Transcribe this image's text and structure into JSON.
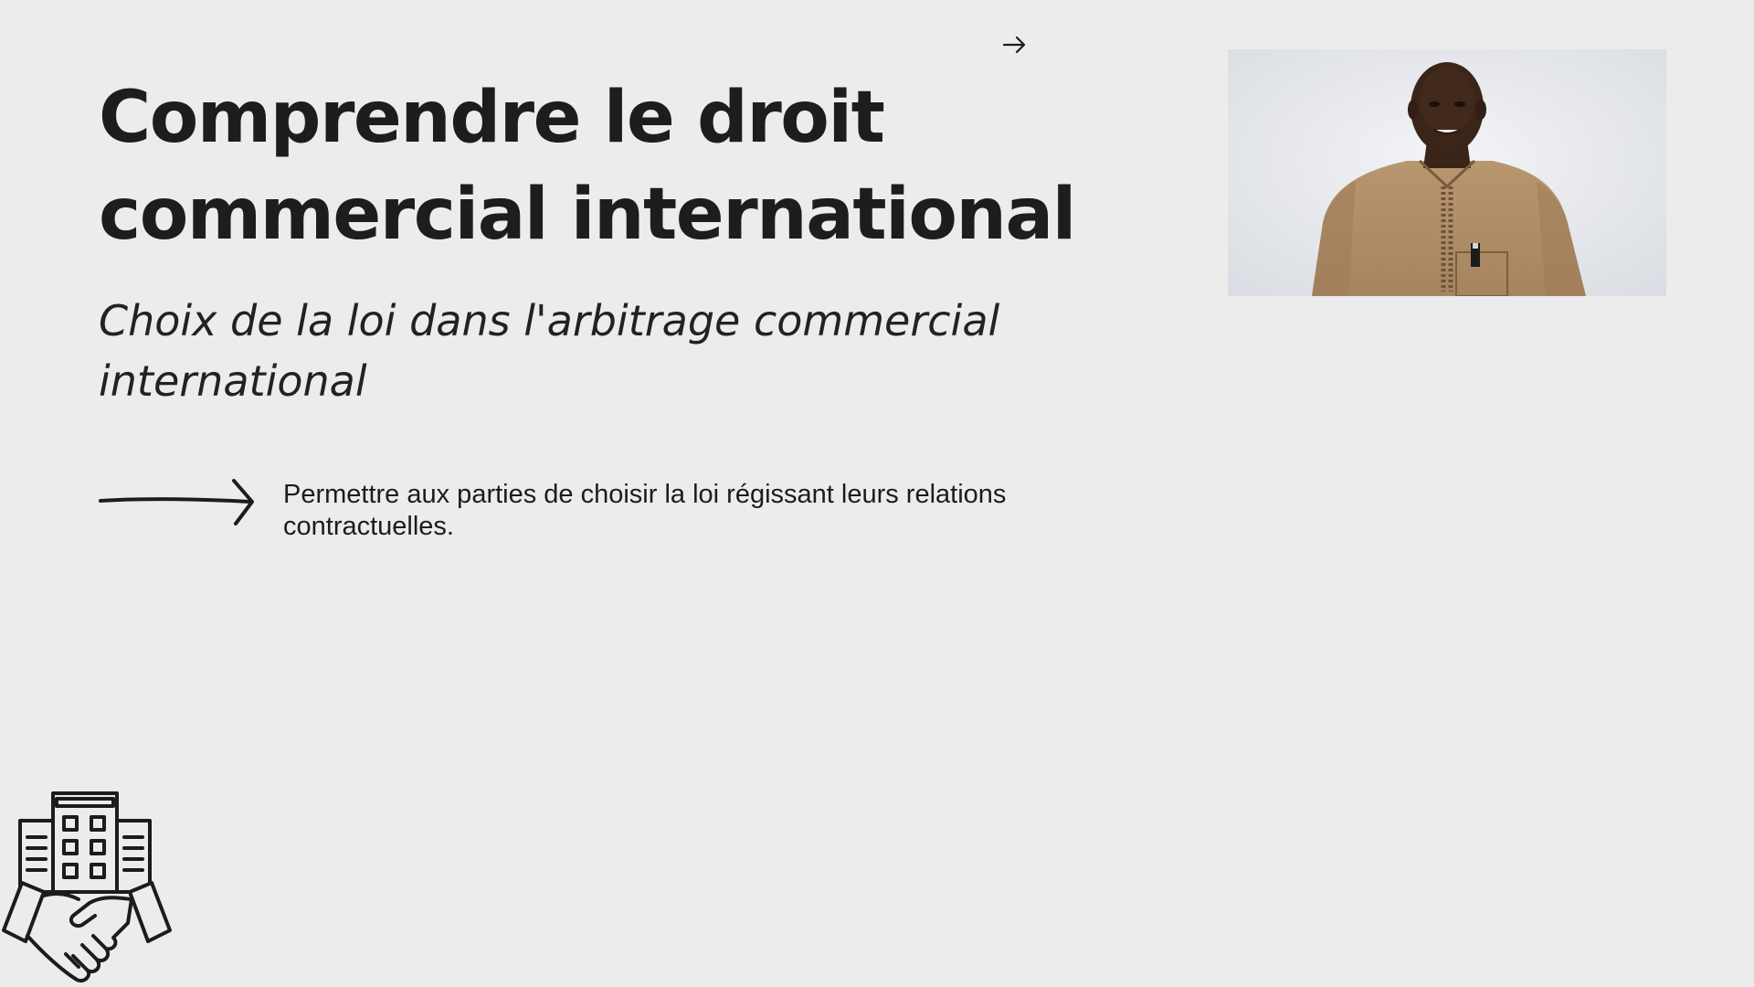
{
  "slide": {
    "title": "Comprendre le droit commercial international",
    "subtitle": "Choix de la loi dans l'arbitrage commercial international",
    "bullet": {
      "icon": "long-arrow-right-icon",
      "text": "Permettre aux parties de choisir la loi régissant leurs relations contractuelles."
    }
  },
  "navigation": {
    "next_icon": "arrow-right-icon"
  },
  "presenter": {
    "icon": "presenter-video"
  },
  "logo": {
    "icon": "building-handshake-icon"
  },
  "colors": {
    "background": "#ececec",
    "text": "#1c1c1c",
    "presenter_robe": "#b08f6a"
  }
}
